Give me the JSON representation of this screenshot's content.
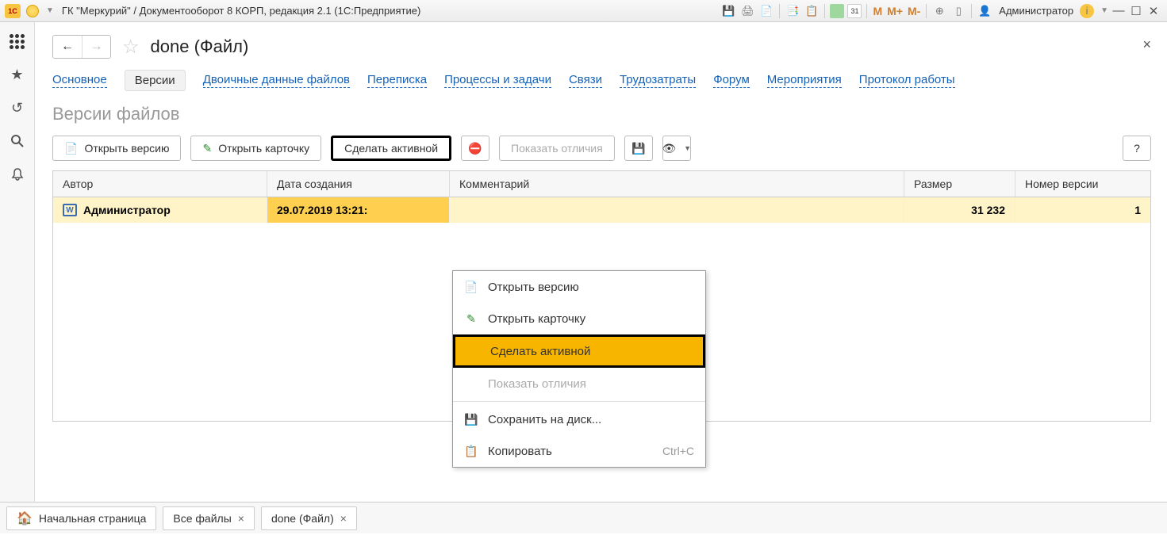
{
  "titlebar": {
    "app_title": "ГК \"Меркурий\" / Документооборот 8 КОРП, редакция 2.1  (1С:Предприятие)",
    "calendar_day": "31",
    "mem": {
      "m": "M",
      "mplus": "M+",
      "mminus": "M-"
    },
    "user_label": "Администратор"
  },
  "leftbar": {
    "star": "★",
    "history": "↺",
    "search": "🔍",
    "bell": "🔔"
  },
  "header": {
    "back": "←",
    "forward": "→",
    "star": "☆",
    "title": "done (Файл)",
    "close": "×"
  },
  "tabs": [
    {
      "label": "Основное",
      "active": false
    },
    {
      "label": "Версии",
      "active": true
    },
    {
      "label": "Двоичные данные файлов",
      "active": false
    },
    {
      "label": "Переписка",
      "active": false
    },
    {
      "label": "Процессы и задачи",
      "active": false
    },
    {
      "label": "Связи",
      "active": false
    },
    {
      "label": "Трудозатраты",
      "active": false
    },
    {
      "label": "Форум",
      "active": false
    },
    {
      "label": "Мероприятия",
      "active": false
    },
    {
      "label": "Протокол работы",
      "active": false
    }
  ],
  "subtitle": "Версии файлов",
  "toolbar": {
    "open_version": "Открыть версию",
    "open_card": "Открыть карточку",
    "make_active": "Сделать активной",
    "show_diff": "Показать отличия",
    "help": "?"
  },
  "table": {
    "headers": {
      "author": "Автор",
      "date": "Дата создания",
      "comment": "Комментарий",
      "size": "Размер",
      "version": "Номер версии"
    },
    "rows": [
      {
        "icon": "W",
        "author": "Администратор",
        "date": "29.07.2019 13:21:",
        "comment": "",
        "size": "31 232",
        "version": "1"
      }
    ]
  },
  "context_menu": {
    "open_version": "Открыть версию",
    "open_card": "Открыть карточку",
    "make_active": "Сделать активной",
    "show_diff": "Показать отличия",
    "save_disk": "Сохранить на диск...",
    "copy": "Копировать",
    "copy_shortcut": "Ctrl+C"
  },
  "bottom_tabs": {
    "home": "Начальная страница",
    "all_files": "Все файлы",
    "done_file": "done (Файл)",
    "close": "×"
  }
}
